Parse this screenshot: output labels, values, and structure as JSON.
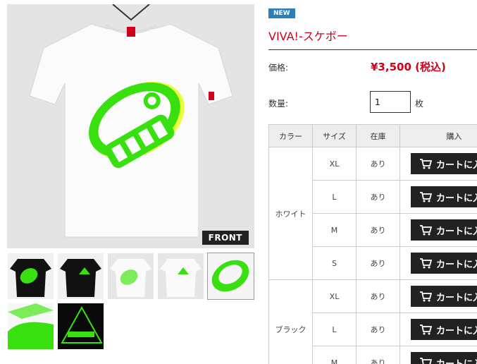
{
  "product": {
    "badge": "NEW",
    "title": "VIVA!-スケボー",
    "price_label": "価格:",
    "price": "¥3,500 (税込)",
    "quantity_label": "数量:",
    "quantity_value": "1",
    "quantity_unit": "枚",
    "main_image_label": "FRONT"
  },
  "table": {
    "headers": [
      "カラー",
      "サイズ",
      "在庫",
      "購入"
    ],
    "cart_label": "カートに入れる",
    "groups": [
      {
        "color": "ホワイト",
        "rows": [
          {
            "size": "XL",
            "stock": "あり"
          },
          {
            "size": "L",
            "stock": "あり"
          },
          {
            "size": "M",
            "stock": "あり"
          },
          {
            "size": "S",
            "stock": "あり"
          }
        ]
      },
      {
        "color": "ブラック",
        "rows": [
          {
            "size": "XL",
            "stock": "あり"
          },
          {
            "size": "L",
            "stock": "あり"
          },
          {
            "size": "M",
            "stock": "あり"
          }
        ]
      }
    ]
  },
  "colors": {
    "accent_red": "#d0021b",
    "badge_blue": "#2c7fb8",
    "neon_green": "#39ff14",
    "button_dark": "#222222"
  }
}
